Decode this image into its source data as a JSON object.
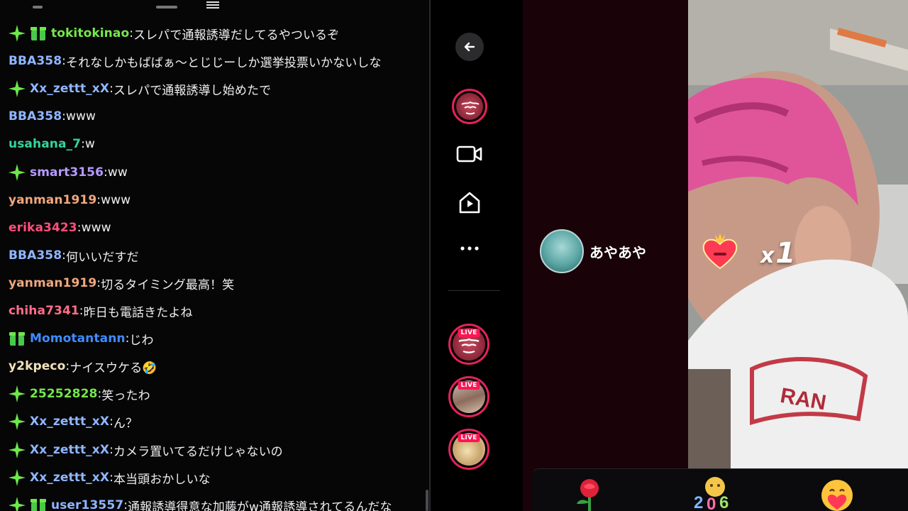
{
  "chat": {
    "messages": [
      {
        "badge": "sparkle+gift",
        "user": "tokitokinao",
        "color": "#74e84c",
        "text": "スレパで通報誘導だしてるやついるぞ"
      },
      {
        "badge": "",
        "user": "BBA358",
        "color": "#8fb6ff",
        "text": "それなしかもばばぁ〜とじじーしか選挙投票いかないしな"
      },
      {
        "badge": "sparkle",
        "user": "Xx_zettt_xX",
        "color": "#8fb6ff",
        "text": "スレパで通報誘導し始めたで"
      },
      {
        "badge": "",
        "user": "BBA358",
        "color": "#8fb6ff",
        "text": "www"
      },
      {
        "badge": "",
        "user": "usahana_7",
        "color": "#36d39a",
        "text": "w"
      },
      {
        "badge": "sparkle",
        "user": "smart3156",
        "color": "#b69bff",
        "text": "ww"
      },
      {
        "badge": "",
        "user": "yanman1919",
        "color": "#f2a77c",
        "text": "www"
      },
      {
        "badge": "",
        "user": "erika3423",
        "color": "#ff4f7a",
        "text": "www"
      },
      {
        "badge": "",
        "user": "BBA358",
        "color": "#8fb6ff",
        "text": "何いいだすだ"
      },
      {
        "badge": "",
        "user": "yanman1919",
        "color": "#f2a77c",
        "text": "切るタイミング最高！笑"
      },
      {
        "badge": "",
        "user": "chiha7341",
        "color": "#ff6d8a",
        "text": "昨日も電話きたよね"
      },
      {
        "badge": "gift",
        "user": "Momotantann",
        "color": "#3f8cff",
        "text": "じわ"
      },
      {
        "badge": "",
        "user": "y2kpeco",
        "color": "#f2e3b8",
        "text": "ナイスウケる🤣"
      },
      {
        "badge": "sparkle",
        "user": "25252828",
        "color": "#74e84c",
        "text": "笑ったわ"
      },
      {
        "badge": "sparkle",
        "user": "Xx_zettt_xX",
        "color": "#8fb6ff",
        "text": "ん？"
      },
      {
        "badge": "sparkle",
        "user": "Xx_zettt_xX",
        "color": "#8fb6ff",
        "text": "カメラ置いてるだけじゃないの"
      },
      {
        "badge": "sparkle",
        "user": "Xx_zettt_xX",
        "color": "#8fb6ff",
        "text": "本当頭おかしいな"
      },
      {
        "badge": "sparkle+gift",
        "user": "user13557",
        "color": "#8fb6ff",
        "text": "通報誘導得意な加藤がw通報誘導されてるんだな"
      }
    ]
  },
  "nav": {
    "icons": [
      "back-arrow-icon",
      "profile-mask-avatar",
      "video-camera-icon",
      "home-play-icon",
      "more-dots-icon"
    ],
    "live_label": "LIVE",
    "live_count": 3
  },
  "stream": {
    "gift_user_name": "あやあや",
    "combo_prefix": "x",
    "combo_count": "1",
    "gift_tray": [
      "rose-gift-icon",
      "number-bear-gift-icon",
      "heart-hug-gift-icon"
    ]
  }
}
